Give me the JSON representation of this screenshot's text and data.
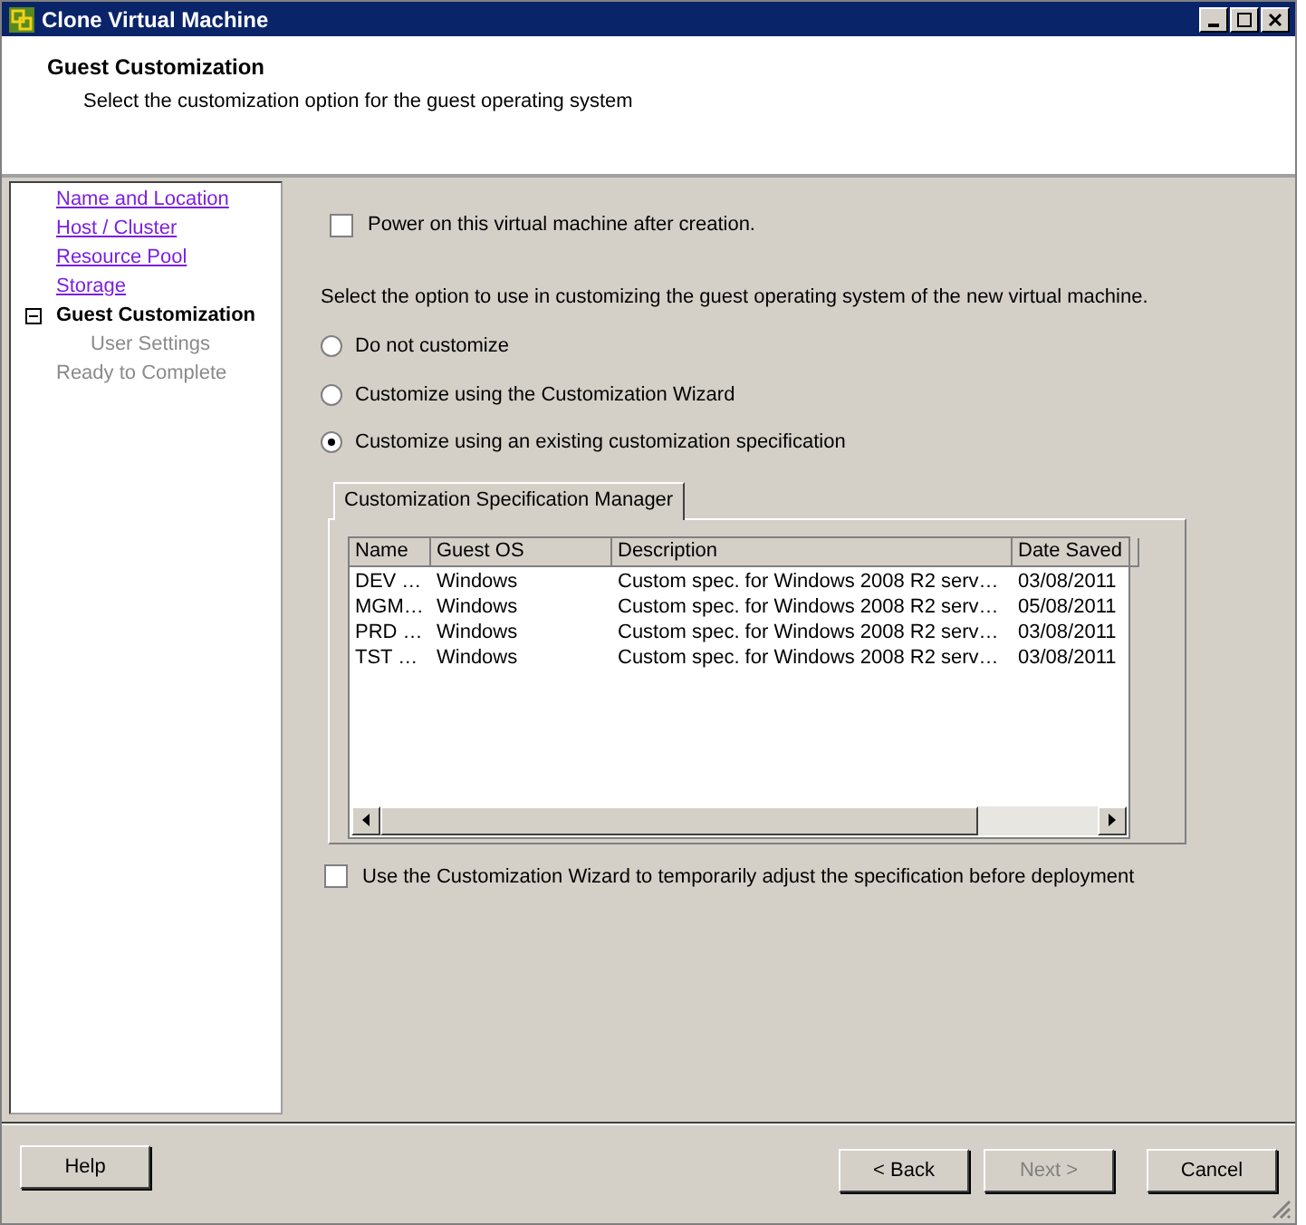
{
  "window": {
    "title": "Clone Virtual Machine"
  },
  "header": {
    "title": "Guest Customization",
    "subtitle": "Select the customization option for the guest operating system"
  },
  "steps": [
    {
      "label": "Name and Location",
      "kind": "done"
    },
    {
      "label": "Host / Cluster",
      "kind": "done"
    },
    {
      "label": "Resource Pool",
      "kind": "done"
    },
    {
      "label": "Storage",
      "kind": "done"
    },
    {
      "label": "Guest Customization",
      "kind": "current",
      "expanded": true,
      "children": [
        {
          "label": "User Settings",
          "kind": "pending"
        }
      ]
    },
    {
      "label": "Ready to Complete",
      "kind": "pending"
    }
  ],
  "power_on": {
    "label": "Power on this virtual machine after creation.",
    "checked": false
  },
  "prompt": "Select the option to use in customizing the guest operating system of the new virtual machine.",
  "options": [
    {
      "label": "Do not customize",
      "selected": false
    },
    {
      "label": "Customize using the Customization Wizard",
      "selected": false
    },
    {
      "label": "Customize using an existing customization specification",
      "selected": true
    }
  ],
  "tab": {
    "label": "Customization Specification Manager"
  },
  "table": {
    "columns": [
      "Name",
      "Guest OS",
      "Description",
      "Date Saved"
    ],
    "rows": [
      [
        "DEV …",
        "Windows",
        "Custom spec. for Windows 2008 R2 serv…",
        "03/08/2011"
      ],
      [
        "MGM…",
        "Windows",
        "Custom spec. for Windows 2008 R2 serv…",
        "05/08/2011"
      ],
      [
        "PRD …",
        "Windows",
        "Custom spec. for Windows 2008 R2 serv…",
        "03/08/2011"
      ],
      [
        "TST …",
        "Windows",
        "Custom spec. for Windows 2008 R2 serv…",
        "03/08/2011"
      ]
    ]
  },
  "adjust": {
    "label": "Use the Customization Wizard to temporarily adjust the specification before deployment",
    "checked": false
  },
  "buttons": [
    {
      "label": "Help",
      "kind": "help",
      "disabled": false
    },
    {
      "label": "< Back",
      "kind": "nav",
      "disabled": false
    },
    {
      "label": "Next >",
      "kind": "nav",
      "disabled": true
    },
    {
      "label": "Cancel",
      "kind": "cancel",
      "disabled": false
    }
  ]
}
